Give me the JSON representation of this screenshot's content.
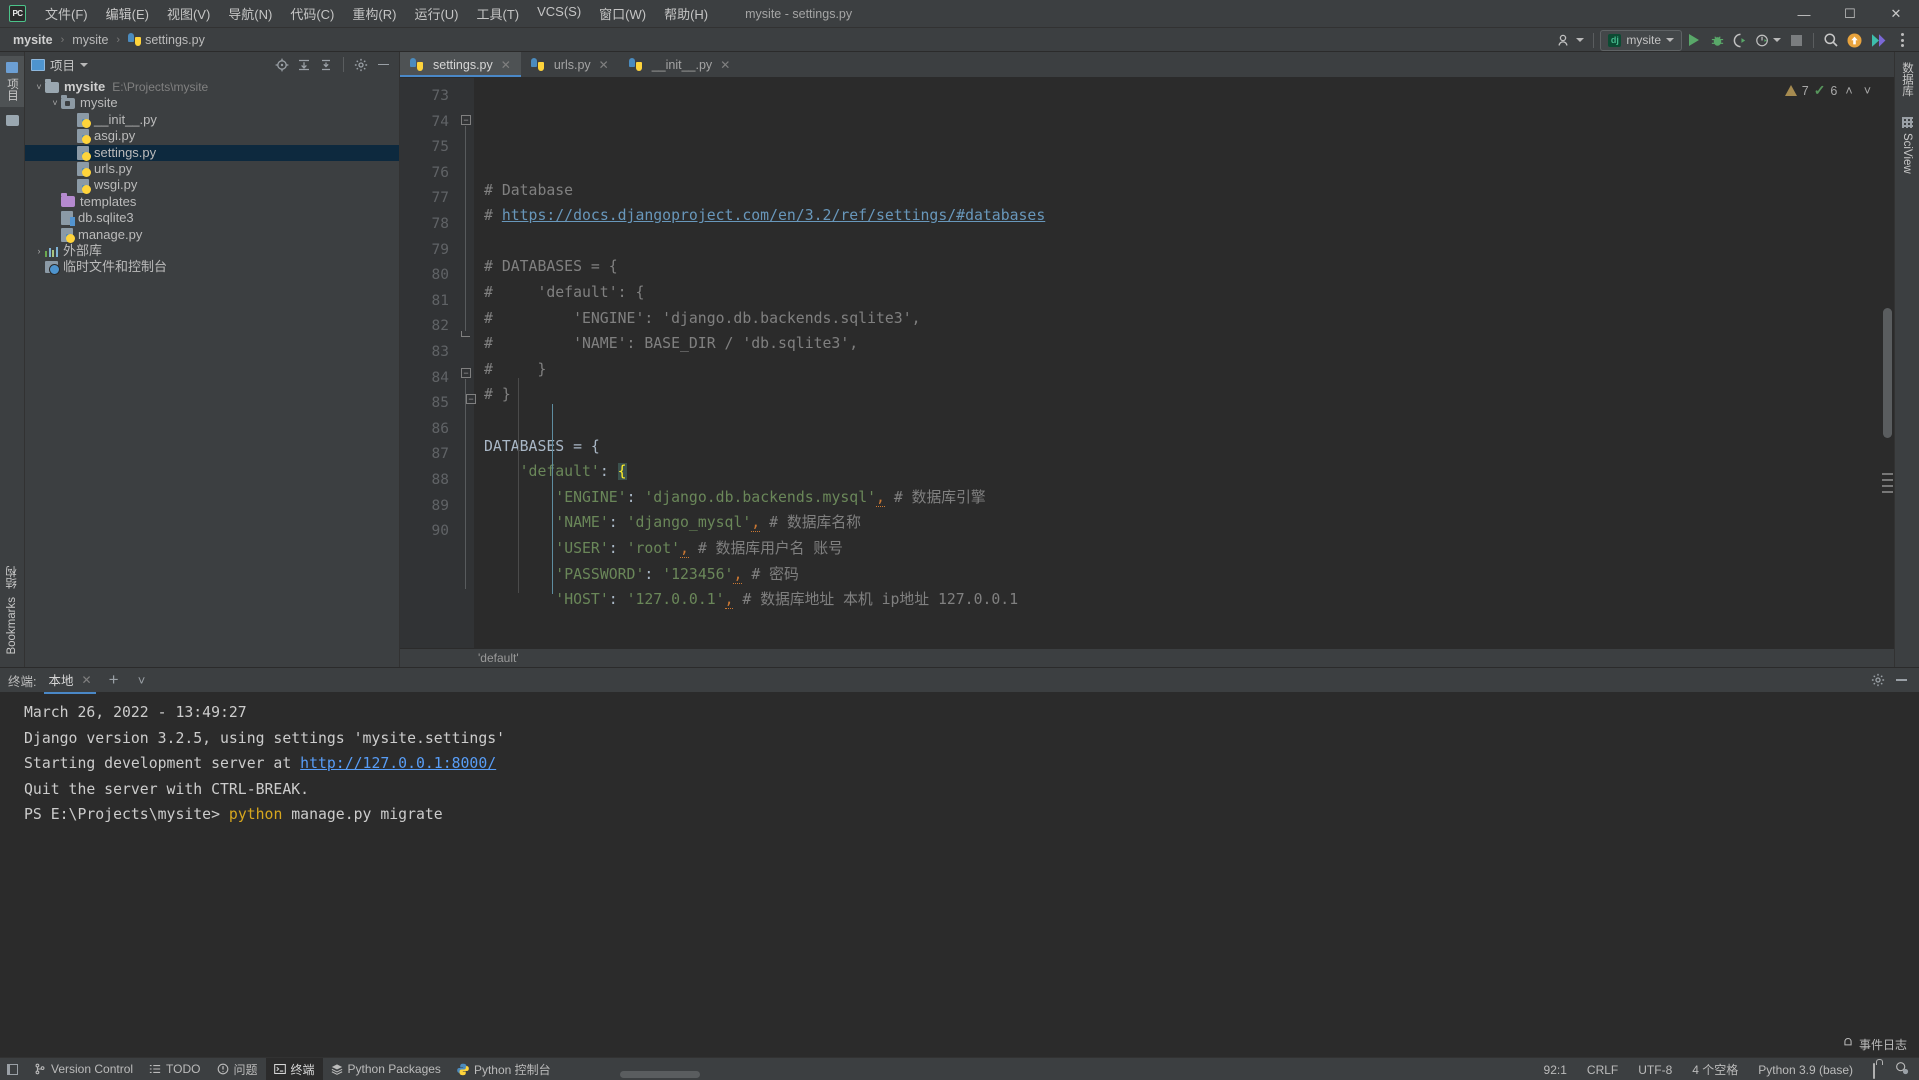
{
  "window": {
    "title": "mysite - settings.py",
    "app_badge": "PC",
    "controls": {
      "minimize": "—",
      "maximize": "☐",
      "close": "✕"
    }
  },
  "menu": [
    {
      "label": "文件(F)"
    },
    {
      "label": "编辑(E)"
    },
    {
      "label": "视图(V)"
    },
    {
      "label": "导航(N)"
    },
    {
      "label": "代码(C)"
    },
    {
      "label": "重构(R)"
    },
    {
      "label": "运行(U)"
    },
    {
      "label": "工具(T)"
    },
    {
      "label": "VCS(S)"
    },
    {
      "label": "窗口(W)"
    },
    {
      "label": "帮助(H)"
    }
  ],
  "breadcrumb": {
    "items": [
      "mysite",
      "mysite",
      "settings.py"
    ],
    "separator": "›"
  },
  "toolbar": {
    "run_config": "mysite",
    "run_config_icon": "django-icon",
    "run_label": "run-button",
    "debug_label": "debug-button",
    "coverage_label": "coverage-button",
    "profile_label": "profile-button",
    "stop_label": "stop-button",
    "search_label": "search-everywhere",
    "update_label": "update-project",
    "settings_label": "settings-button",
    "user_label": "user-account"
  },
  "left_strip": {
    "top_tab": "项目",
    "bottom_tabs": [
      "结构",
      "Bookmarks"
    ]
  },
  "right_strip": {
    "tabs": [
      "数据库",
      "SciView"
    ]
  },
  "project_panel": {
    "title": "项目",
    "actions": [
      "locate-icon",
      "expand-all-icon",
      "collapse-all-icon",
      "gear-icon",
      "hide-icon"
    ],
    "tree": [
      {
        "depth": 0,
        "arrow": "˅",
        "icon": "folder",
        "label": "mysite",
        "bold": true,
        "path": "E:\\Projects\\mysite",
        "selected": false
      },
      {
        "depth": 1,
        "arrow": "˅",
        "icon": "folder-module",
        "label": "mysite",
        "bold": false,
        "path": "",
        "selected": false
      },
      {
        "depth": 2,
        "arrow": "",
        "icon": "python-file",
        "label": "__init__.py",
        "bold": false,
        "path": "",
        "selected": false
      },
      {
        "depth": 2,
        "arrow": "",
        "icon": "python-file",
        "label": "asgi.py",
        "bold": false,
        "path": "",
        "selected": false
      },
      {
        "depth": 2,
        "arrow": "",
        "icon": "python-file",
        "label": "settings.py",
        "bold": false,
        "path": "",
        "selected": true
      },
      {
        "depth": 2,
        "arrow": "",
        "icon": "python-file",
        "label": "urls.py",
        "bold": false,
        "path": "",
        "selected": false
      },
      {
        "depth": 2,
        "arrow": "",
        "icon": "python-file",
        "label": "wsgi.py",
        "bold": false,
        "path": "",
        "selected": false
      },
      {
        "depth": 1,
        "arrow": "",
        "icon": "folder-purple",
        "label": "templates",
        "bold": false,
        "path": "",
        "selected": false
      },
      {
        "depth": 1,
        "arrow": "",
        "icon": "sqlite-file",
        "label": "db.sqlite3",
        "bold": false,
        "path": "",
        "selected": false
      },
      {
        "depth": 1,
        "arrow": "",
        "icon": "python-file",
        "label": "manage.py",
        "bold": false,
        "path": "",
        "selected": false
      },
      {
        "depth": 0,
        "arrow": "›",
        "icon": "library",
        "label": "外部库",
        "bold": false,
        "path": "",
        "selected": false
      },
      {
        "depth": 0,
        "arrow": "",
        "icon": "scratches",
        "label": "临时文件和控制台",
        "bold": false,
        "path": "",
        "selected": false
      }
    ]
  },
  "editor": {
    "tabs": [
      {
        "label": "settings.py",
        "active": true
      },
      {
        "label": "urls.py",
        "active": false
      },
      {
        "label": "__init__.py",
        "active": false
      }
    ],
    "close_glyph": "✕",
    "inspection": {
      "warning_count": "7",
      "ok_count": "6",
      "up": "˄",
      "down": "˅"
    },
    "breadcrumb_text": "'default'",
    "first_line_number": 73,
    "lines": [
      {
        "n": 73,
        "segments": []
      },
      {
        "n": 74,
        "segments": [
          {
            "t": "# Database",
            "c": "cmt"
          }
        ]
      },
      {
        "n": 75,
        "segments": [
          {
            "t": "# ",
            "c": "cmt"
          },
          {
            "t": "https://docs.djangoproject.com/en/3.2/ref/settings/#databases",
            "c": "cmt-link"
          }
        ]
      },
      {
        "n": 76,
        "segments": []
      },
      {
        "n": 77,
        "segments": [
          {
            "t": "# DATABASES = {",
            "c": "cmt"
          }
        ]
      },
      {
        "n": 78,
        "segments": [
          {
            "t": "#     'default': {",
            "c": "cmt"
          }
        ]
      },
      {
        "n": 79,
        "segments": [
          {
            "t": "#         'ENGINE': 'django.db.backends.sqlite3',",
            "c": "cmt"
          }
        ]
      },
      {
        "n": 80,
        "segments": [
          {
            "t": "#         'NAME': BASE_DIR / 'db.sqlite3',",
            "c": "cmt"
          }
        ]
      },
      {
        "n": 81,
        "segments": [
          {
            "t": "#     }",
            "c": "cmt"
          }
        ]
      },
      {
        "n": 82,
        "segments": [
          {
            "t": "# }",
            "c": "cmt"
          }
        ]
      },
      {
        "n": 83,
        "segments": []
      },
      {
        "n": 84,
        "segments": [
          {
            "t": "DATABASES = {",
            "c": "kw"
          }
        ]
      },
      {
        "n": 85,
        "segments": [
          {
            "t": "    ",
            "c": "kw"
          },
          {
            "t": "'default'",
            "c": "str"
          },
          {
            "t": ": ",
            "c": "kw"
          },
          {
            "t": "{",
            "c": "brace-hl"
          }
        ]
      },
      {
        "n": 86,
        "segments": [
          {
            "t": "        ",
            "c": "kw"
          },
          {
            "t": "'ENGINE'",
            "c": "str"
          },
          {
            "t": ": ",
            "c": "kw"
          },
          {
            "t": "'django.db.backends.mysql'",
            "c": "str"
          },
          {
            "t": ",",
            "c": "comma-err"
          },
          {
            "t": " ",
            "c": "kw"
          },
          {
            "t": "# 数据库引擎",
            "c": "cmt"
          }
        ]
      },
      {
        "n": 87,
        "segments": [
          {
            "t": "        ",
            "c": "kw"
          },
          {
            "t": "'NAME'",
            "c": "str"
          },
          {
            "t": ": ",
            "c": "kw"
          },
          {
            "t": "'django_mysql'",
            "c": "str"
          },
          {
            "t": ",",
            "c": "comma-err"
          },
          {
            "t": " ",
            "c": "kw"
          },
          {
            "t": "# 数据库名称",
            "c": "cmt"
          }
        ]
      },
      {
        "n": 88,
        "segments": [
          {
            "t": "        ",
            "c": "kw"
          },
          {
            "t": "'USER'",
            "c": "str"
          },
          {
            "t": ": ",
            "c": "kw"
          },
          {
            "t": "'root'",
            "c": "str"
          },
          {
            "t": ",",
            "c": "comma-err"
          },
          {
            "t": " ",
            "c": "kw"
          },
          {
            "t": "# 数据库用户名 账号",
            "c": "cmt"
          }
        ]
      },
      {
        "n": 89,
        "segments": [
          {
            "t": "        ",
            "c": "kw"
          },
          {
            "t": "'PASSWORD'",
            "c": "str"
          },
          {
            "t": ": ",
            "c": "kw"
          },
          {
            "t": "'123456'",
            "c": "str"
          },
          {
            "t": ",",
            "c": "comma-err"
          },
          {
            "t": " ",
            "c": "kw"
          },
          {
            "t": "# 密码",
            "c": "cmt"
          }
        ]
      },
      {
        "n": 90,
        "segments": [
          {
            "t": "        ",
            "c": "kw"
          },
          {
            "t": "'HOST'",
            "c": "str"
          },
          {
            "t": ": ",
            "c": "kw"
          },
          {
            "t": "'127.0.0.1'",
            "c": "str"
          },
          {
            "t": ",",
            "c": "comma-err"
          },
          {
            "t": " ",
            "c": "kw"
          },
          {
            "t": "# 数据库地址 本机 ip地址 127.0.0.1",
            "c": "cmt"
          }
        ]
      }
    ]
  },
  "terminal": {
    "label": "终端:",
    "tab": "本地",
    "tab_close": "✕",
    "add": "+",
    "dropdown": "˅",
    "settings_icon": "gear-icon",
    "hide_icon": "hide-icon",
    "lines": [
      {
        "segments": [
          {
            "t": "March 26, 2022 - 13:49:27",
            "c": ""
          }
        ]
      },
      {
        "segments": [
          {
            "t": "Django version 3.2.5, using settings 'mysite.settings'",
            "c": ""
          }
        ]
      },
      {
        "segments": [
          {
            "t": "Starting development server at ",
            "c": ""
          },
          {
            "t": "http://127.0.0.1:8000/",
            "c": "tlink"
          }
        ]
      },
      {
        "segments": [
          {
            "t": "Quit the server with CTRL-BREAK.",
            "c": ""
          }
        ]
      },
      {
        "segments": [
          {
            "t": "PS E:\\Projects\\mysite> ",
            "c": ""
          },
          {
            "t": "python",
            "c": "tyellow"
          },
          {
            "t": " manage.py migrate",
            "c": ""
          }
        ]
      }
    ]
  },
  "statusbar": {
    "left_items": [
      {
        "label": "Version Control",
        "icon": "branch-icon",
        "active": false
      },
      {
        "label": "TODO",
        "icon": "list-icon",
        "active": false
      },
      {
        "label": "问题",
        "icon": "problem-icon",
        "active": false
      },
      {
        "label": "终端",
        "icon": "terminal-icon",
        "active": true
      },
      {
        "label": "Python Packages",
        "icon": "layers-icon",
        "active": false
      },
      {
        "label": "Python 控制台",
        "icon": "python-icon",
        "active": false
      }
    ],
    "event_log": "事件日志",
    "right_items": [
      "92:1",
      "CRLF",
      "UTF-8",
      "4 个空格",
      "Python 3.9 (base)"
    ]
  },
  "colors": {
    "accent": "#4a88c7",
    "selection": "#0d293e",
    "panel_bg": "#3c3f41",
    "editor_bg": "#2b2b2b",
    "string": "#6A8759",
    "comment": "#808080",
    "link": "#6897BB",
    "run_green": "#59A869",
    "warning": "#A68B50"
  }
}
